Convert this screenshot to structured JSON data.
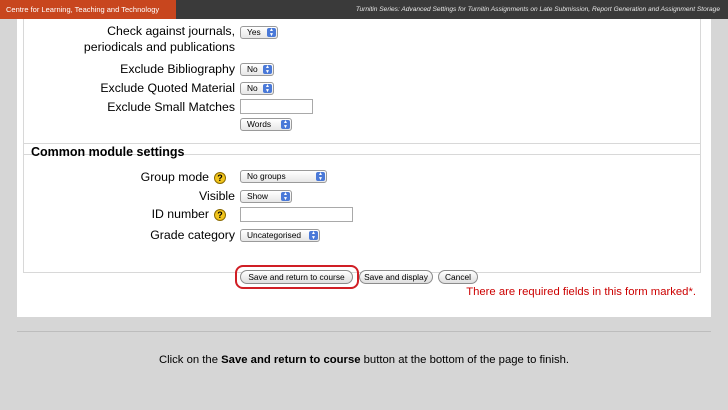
{
  "header": {
    "left": "Centre for Learning, Teaching and Technology",
    "right": "Turnitin Series: Advanced Settings for Turnitin Assignments on Late Submission, Report Generation and Assignment Storage"
  },
  "turnitin_settings": {
    "check_journals": {
      "label_line1": "Check against journals,",
      "label_line2": "periodicals and publications",
      "value": "Yes"
    },
    "exclude_bibliography": {
      "label": "Exclude Bibliography",
      "value": "No"
    },
    "exclude_quoted": {
      "label": "Exclude Quoted Material",
      "value": "No"
    },
    "exclude_small": {
      "label": "Exclude Small Matches",
      "value": "",
      "unit": "Words"
    }
  },
  "common": {
    "legend": "Common module settings",
    "group_mode": {
      "label": "Group mode",
      "value": "No groups"
    },
    "visible": {
      "label": "Visible",
      "value": "Show"
    },
    "id_number": {
      "label": "ID number",
      "value": ""
    },
    "grade_category": {
      "label": "Grade category",
      "value": "Uncategorised"
    }
  },
  "help_glyph": "?",
  "buttons": {
    "save_return": "Save and return to course",
    "save_display": "Save and display",
    "cancel": "Cancel"
  },
  "required_note": "There are required fields in this form marked",
  "required_mark": "*.",
  "caption": {
    "before": "Click on the ",
    "bold": "Save and return to course",
    "after": " button at the bottom of the page to finish."
  },
  "colors": {
    "header_accent": "#c8461e",
    "highlight_ring": "#d01e25",
    "required_text": "#cc0000",
    "select_arrow": "#4a79d8"
  }
}
